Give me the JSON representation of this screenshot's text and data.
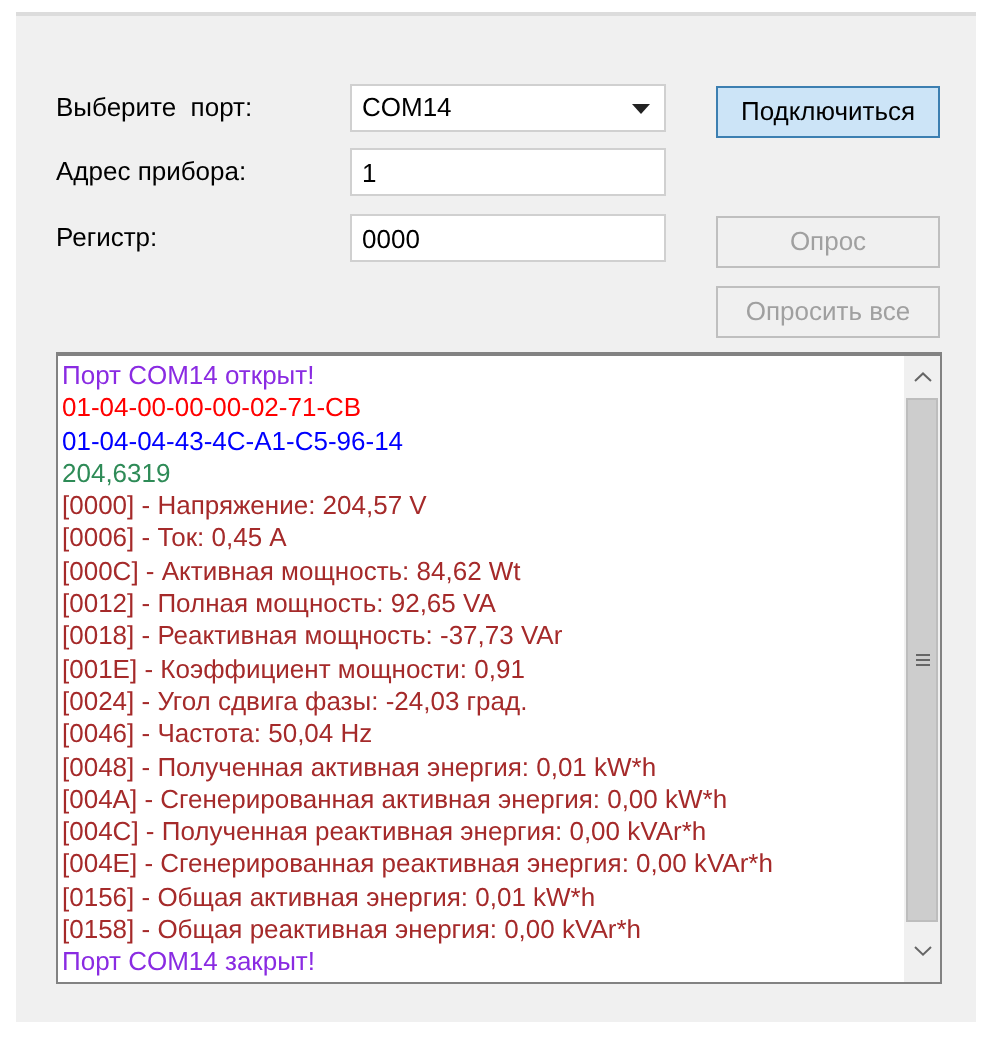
{
  "form": {
    "port_label": "Выберите  порт:",
    "port_value": "COM14",
    "address_label": "Адрес прибора:",
    "address_value": "1",
    "register_label": "Регистр:",
    "register_value": "0000"
  },
  "buttons": [
    {
      "label": "Подключиться",
      "disabled": false,
      "focused": true
    },
    {
      "label": "Опрос",
      "disabled": true,
      "focused": false
    },
    {
      "label": "Опросить все",
      "disabled": true,
      "focused": false
    }
  ],
  "log": [
    {
      "text": "Порт COM14 открыт!",
      "color": "#8a2be2"
    },
    {
      "text": "01-04-00-00-00-02-71-CB",
      "color": "#ff0000"
    },
    {
      "text": "01-04-04-43-4C-A1-C5-96-14",
      "color": "#0000ff"
    },
    {
      "text": "204,6319",
      "color": "#2e8b57"
    },
    {
      "text": "[0000] - Напряжение: 204,57 V",
      "color": "#a52a2a"
    },
    {
      "text": "[0006] - Ток: 0,45 A",
      "color": "#a52a2a"
    },
    {
      "text": "[000C] - Активная мощность: 84,62 Wt",
      "color": "#a52a2a"
    },
    {
      "text": "[0012] - Полная мощность: 92,65 VA",
      "color": "#a52a2a"
    },
    {
      "text": "[0018] - Реактивная мощность: -37,73 VAr",
      "color": "#a52a2a"
    },
    {
      "text": "[001E] - Коэффициент мощности: 0,91",
      "color": "#a52a2a"
    },
    {
      "text": "[0024] - Угол сдвига фазы: -24,03 град.",
      "color": "#a52a2a"
    },
    {
      "text": "[0046] - Частота: 50,04 Hz",
      "color": "#a52a2a"
    },
    {
      "text": "[0048] - Полученная активная энергия: 0,01 kW*h",
      "color": "#a52a2a"
    },
    {
      "text": "[004A] - Сгенерированная активная энергия: 0,00 kW*h",
      "color": "#a52a2a"
    },
    {
      "text": "[004C] - Полученная реактивная энергия: 0,00 kVAr*h",
      "color": "#a52a2a"
    },
    {
      "text": "[004E] - Сгенерированная реактивная энергия: 0,00 kVAr*h",
      "color": "#a52a2a"
    },
    {
      "text": "[0156] - Общая активная энергия: 0,01 kW*h",
      "color": "#a52a2a"
    },
    {
      "text": "[0158] - Общая реактивная энергия: 0,00 kVAr*h",
      "color": "#a52a2a"
    },
    {
      "text": "Порт COM14 закрыт!",
      "color": "#8a2be2"
    }
  ]
}
